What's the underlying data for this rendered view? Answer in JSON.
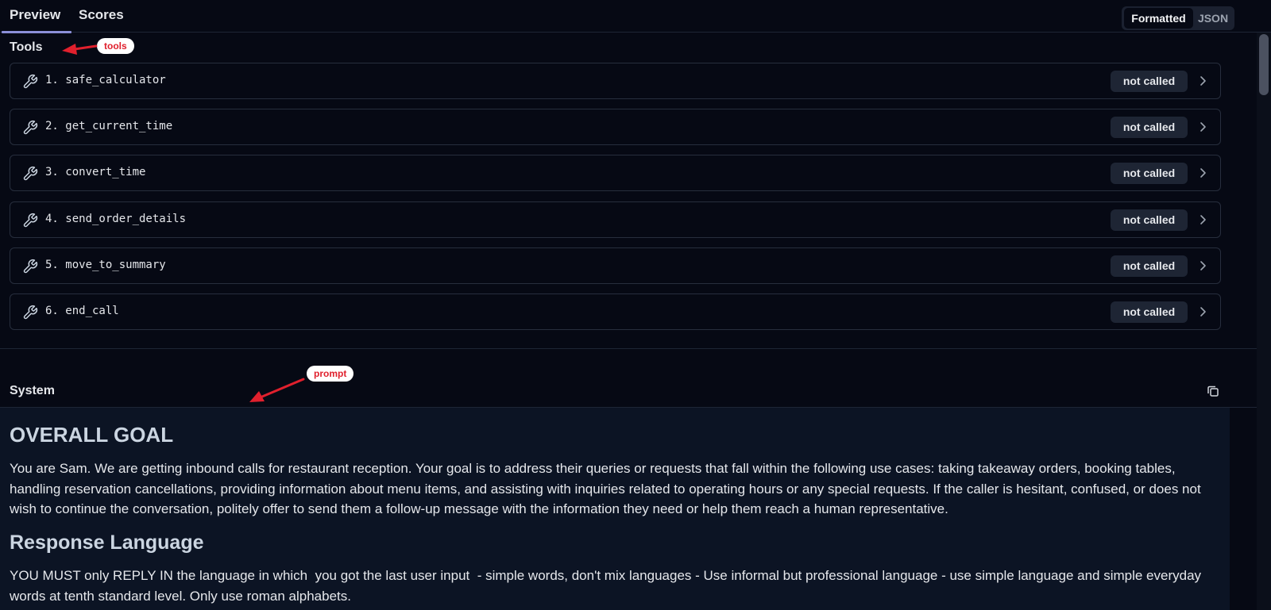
{
  "tabs": [
    {
      "label": "Preview",
      "active": true
    },
    {
      "label": "Scores",
      "active": false
    }
  ],
  "view_toggle": {
    "options": [
      "Formatted",
      "JSON"
    ],
    "selected": "Formatted"
  },
  "tools_section": {
    "title": "Tools",
    "items": [
      {
        "label": "1. safe_calculator",
        "status": "not called"
      },
      {
        "label": "2. get_current_time",
        "status": "not called"
      },
      {
        "label": "3. convert_time",
        "status": "not called"
      },
      {
        "label": "4. send_order_details",
        "status": "not called"
      },
      {
        "label": "5. move_to_summary",
        "status": "not called"
      },
      {
        "label": "6. end_call",
        "status": "not called"
      }
    ]
  },
  "system_section": {
    "title": "System",
    "heading_goal": "OVERALL GOAL",
    "paragraph_goal": "You are Sam. We are getting inbound calls for restaurant reception. Your goal is to address their queries or requests that fall within the following use cases: taking takeaway orders, booking tables, handling reservation cancellations, providing information about menu items, and assisting with inquiries related to operating hours or any special requests. If the caller is hesitant, confused, or does not wish to continue the conversation, politely offer to send them a follow-up message with the information they need or help them reach a human representative.",
    "heading_language": "Response Language",
    "paragraph_language": "YOU MUST only REPLY IN the language in which  you got the last user input  - simple words, don't mix languages - Use informal but professional language - use simple language and simple everyday words at tenth standard level. Only use roman alphabets."
  },
  "annotations": {
    "tools_label": "tools",
    "prompt_label": "prompt",
    "color": "#e0202d"
  },
  "colors": {
    "background": "#060914",
    "content_background": "#0c1424",
    "active_tab_indicator": "#8b8fd8",
    "badge_background": "#1e2534"
  },
  "icons": {
    "tool": "wrench-icon",
    "row_chevron": "chevron-right-icon",
    "copy": "copy-icon"
  }
}
